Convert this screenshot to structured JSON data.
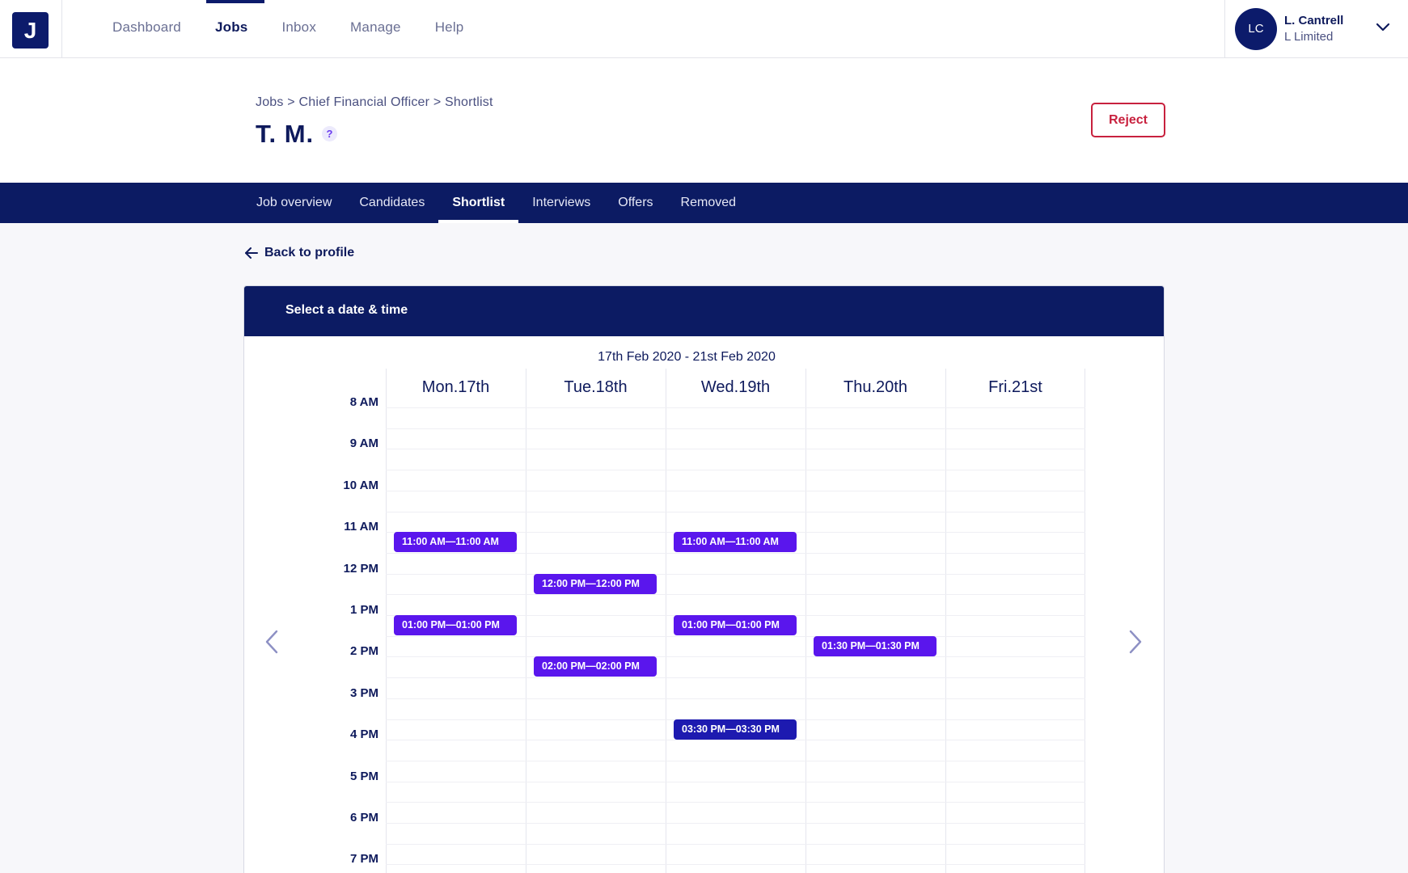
{
  "app": {
    "logo_letter": "J"
  },
  "topnav": {
    "items": [
      {
        "label": "Dashboard"
      },
      {
        "label": "Jobs",
        "active": true
      },
      {
        "label": "Inbox"
      },
      {
        "label": "Manage"
      },
      {
        "label": "Help"
      }
    ],
    "user": {
      "initials": "LC",
      "name": "L. Cantrell",
      "company": "L Limited"
    }
  },
  "header": {
    "breadcrumb": [
      "Jobs",
      "Chief Financial Officer",
      "Shortlist"
    ],
    "breadcrumb_separator": ">",
    "title": "T. M.",
    "help_symbol": "?",
    "reject_label": "Reject"
  },
  "tabs": [
    {
      "label": "Job overview"
    },
    {
      "label": "Candidates"
    },
    {
      "label": "Shortlist",
      "active": true
    },
    {
      "label": "Interviews"
    },
    {
      "label": "Offers"
    },
    {
      "label": "Removed"
    }
  ],
  "back_link": "Back to profile",
  "scheduler": {
    "title": "Select a date & time",
    "range": "17th Feb 2020 - 21st Feb 2020",
    "days": [
      "Mon.17th",
      "Tue.18th",
      "Wed.19th",
      "Thu.20th",
      "Fri.21st"
    ],
    "hours": [
      "8 AM",
      "9 AM",
      "10 AM",
      "11 AM",
      "12 PM",
      "1 PM",
      "2 PM",
      "3 PM",
      "4 PM",
      "5 PM",
      "6 PM",
      "7 PM"
    ],
    "slots": [
      {
        "day": 0,
        "start_hour": 11.0,
        "label": "11:00 AM—11:00 AM"
      },
      {
        "day": 0,
        "start_hour": 13.0,
        "label": "01:00 PM—01:00 PM"
      },
      {
        "day": 1,
        "start_hour": 12.0,
        "label": "12:00 PM—12:00 PM"
      },
      {
        "day": 1,
        "start_hour": 14.0,
        "label": "02:00 PM—02:00 PM"
      },
      {
        "day": 2,
        "start_hour": 11.0,
        "label": "11:00 AM—11:00 AM"
      },
      {
        "day": 2,
        "start_hour": 13.0,
        "label": "01:00 PM—01:00 PM"
      },
      {
        "day": 2,
        "start_hour": 15.5,
        "label": "03:30 PM—03:30 PM",
        "selected": true
      },
      {
        "day": 3,
        "start_hour": 13.5,
        "label": "01:30 PM—01:30 PM"
      }
    ]
  },
  "colors": {
    "navy": "#0c1b63",
    "slot": "#5a16ed",
    "slot_selected": "#1d1ab0",
    "reject": "#c8213e"
  },
  "icons": {
    "help": "question-circle-icon",
    "chevron": "chevron-down-icon",
    "back": "arrow-left-icon",
    "prev": "chevron-left-icon",
    "next": "chevron-right-icon"
  }
}
